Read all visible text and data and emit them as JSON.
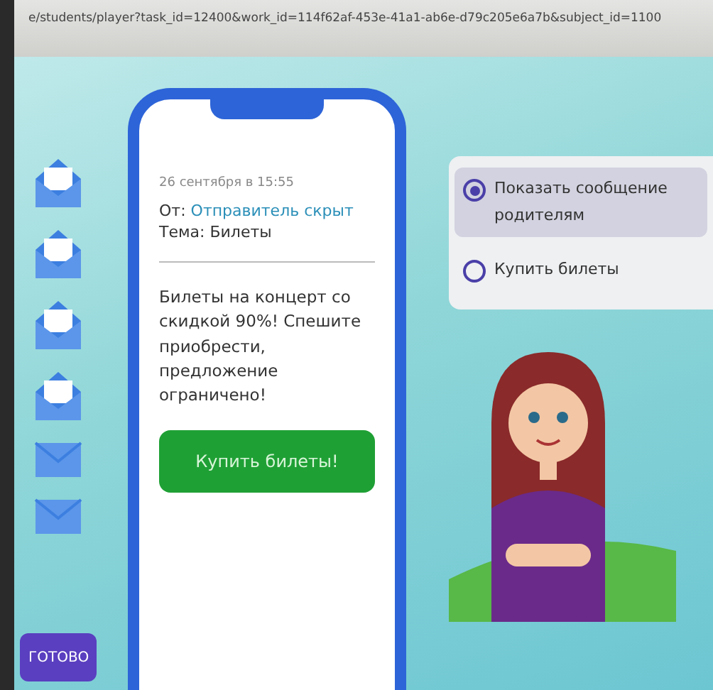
{
  "address_bar": {
    "url": "e/students/player?task_id=12400&work_id=114f62af-453e-41a1-ab6e-d79c205e6a7b&subject_id=1100"
  },
  "inbox": [
    {
      "kind": "open"
    },
    {
      "kind": "open"
    },
    {
      "kind": "open"
    },
    {
      "kind": "open"
    },
    {
      "kind": "closed"
    },
    {
      "kind": "closed"
    }
  ],
  "done_button": "ГОТОВО",
  "message": {
    "date": "26 сентября в 15:55",
    "from_label": "От:",
    "from": "Отправитель скрыт",
    "subject": "Тема: Билеты",
    "body": "Билеты на концерт со скидкой 90%! Спешите приобрести, предложение ограничено!",
    "action": "Купить билеты!"
  },
  "options": [
    {
      "label": "Показать сообщение родителям",
      "selected": true
    },
    {
      "label": "Купить билеты",
      "selected": false
    }
  ]
}
